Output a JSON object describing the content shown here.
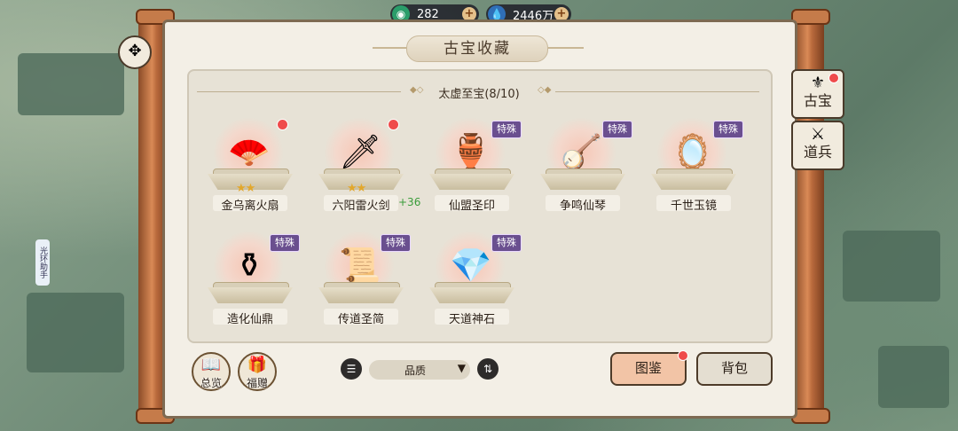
{
  "currency": {
    "jade": {
      "icon": "jade-orb-icon",
      "value": "282"
    },
    "spirit": {
      "icon": "water-drop-icon",
      "value": "2446万"
    }
  },
  "header": {
    "title": "古宝收藏"
  },
  "section": {
    "title": "太虚至宝(8/10)"
  },
  "items": [
    {
      "name": "金乌离火扇",
      "tag": "",
      "red_dot": true,
      "stars": 2,
      "bonus": "",
      "glow": "red",
      "icon": "fire-fan-icon"
    },
    {
      "name": "六阳雷火剑",
      "tag": "",
      "red_dot": true,
      "stars": 2,
      "bonus": "+36",
      "glow": "red",
      "icon": "thunder-sword-icon"
    },
    {
      "name": "仙盟圣印",
      "tag": "特殊",
      "red_dot": false,
      "stars": 0,
      "bonus": "",
      "glow": "red",
      "icon": "seal-icon"
    },
    {
      "name": "争鸣仙琴",
      "tag": "特殊",
      "red_dot": false,
      "stars": 0,
      "bonus": "",
      "glow": "red",
      "icon": "zither-icon"
    },
    {
      "name": "千世玉镜",
      "tag": "特殊",
      "red_dot": false,
      "stars": 0,
      "bonus": "",
      "glow": "red",
      "icon": "jade-mirror-icon"
    },
    {
      "name": "造化仙鼎",
      "tag": "特殊",
      "red_dot": false,
      "stars": 0,
      "bonus": "",
      "glow": "red",
      "icon": "cauldron-icon"
    },
    {
      "name": "传道圣简",
      "tag": "特殊",
      "red_dot": false,
      "stars": 0,
      "bonus": "",
      "glow": "red",
      "icon": "scroll-slips-icon"
    },
    {
      "name": "天道神石",
      "tag": "特殊",
      "red_dot": false,
      "stars": 0,
      "bonus": "",
      "glow": "red",
      "icon": "divine-stone-icon"
    }
  ],
  "side_tabs": [
    {
      "label": "古宝",
      "icon": "treasure-icon",
      "red_dot": true
    },
    {
      "label": "道兵",
      "icon": "soldier-icon",
      "red_dot": false
    }
  ],
  "bottom": {
    "overview_label": "总览",
    "gift_label": "福赠",
    "sort_value": "品质",
    "catalog_label": "图鉴",
    "bag_label": "背包"
  },
  "sidebar_hint": "光环助手",
  "colors": {
    "tag_purple": "#6a4f8f",
    "red_dot": "#ef4b4b",
    "bonus_green": "#3a9c3a",
    "star_gold": "#e2a72c"
  }
}
